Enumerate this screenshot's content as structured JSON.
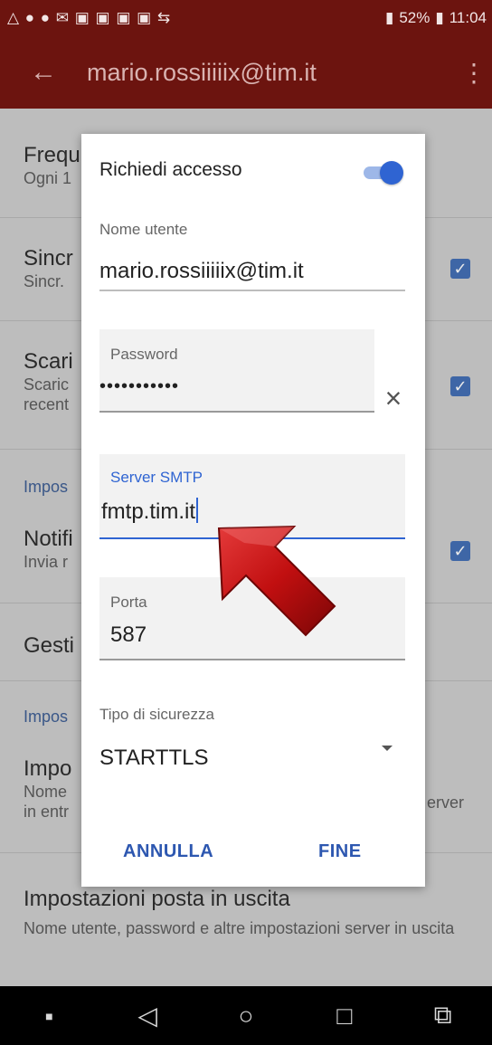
{
  "statusbar": {
    "left_icons": "△ ● ● ✉ ▣ ▣ ▣ ▣ ⇆",
    "battery": "52%",
    "time": "11:04"
  },
  "appbar": {
    "title": "mario.rossiiiiix@tim.it"
  },
  "background": {
    "item1_title": "Frequ",
    "item1_sub": "Ogni 1",
    "item2_title": "Sincr",
    "item2_sub": "Sincr.",
    "item3_title": "Scari",
    "item3_sub1": "Scaric",
    "item3_sub2": "recent",
    "section1": "Impos",
    "item4_title": "Notifi",
    "item4_sub": "Invia r",
    "item5_title": "Gesti",
    "section2": "Impos",
    "item6_title": "Impo",
    "item6_sub1": "Nome",
    "item6_sub2": "in entr",
    "item6_right": "erver",
    "item7_title": "Impostazioni posta in uscita",
    "item7_sub": "Nome utente, password e altre impostazioni server in uscita"
  },
  "dialog": {
    "header": "Richiedi accesso",
    "username_label": "Nome utente",
    "username_value": "mario.rossiiiiix@tim.it",
    "password_label": "Password",
    "password_value": "•••••••••••",
    "smtp_label": "Server SMTP",
    "smtp_value": "fmtp.tim.it",
    "port_label": "Porta",
    "port_value": "587",
    "security_label": "Tipo di sicurezza",
    "security_value": "STARTTLS",
    "cancel": "ANNULLA",
    "done": "FINE"
  },
  "colors": {
    "accent": "#2f64d2",
    "bar": "#6c140f",
    "arrow": "#c10f10"
  }
}
